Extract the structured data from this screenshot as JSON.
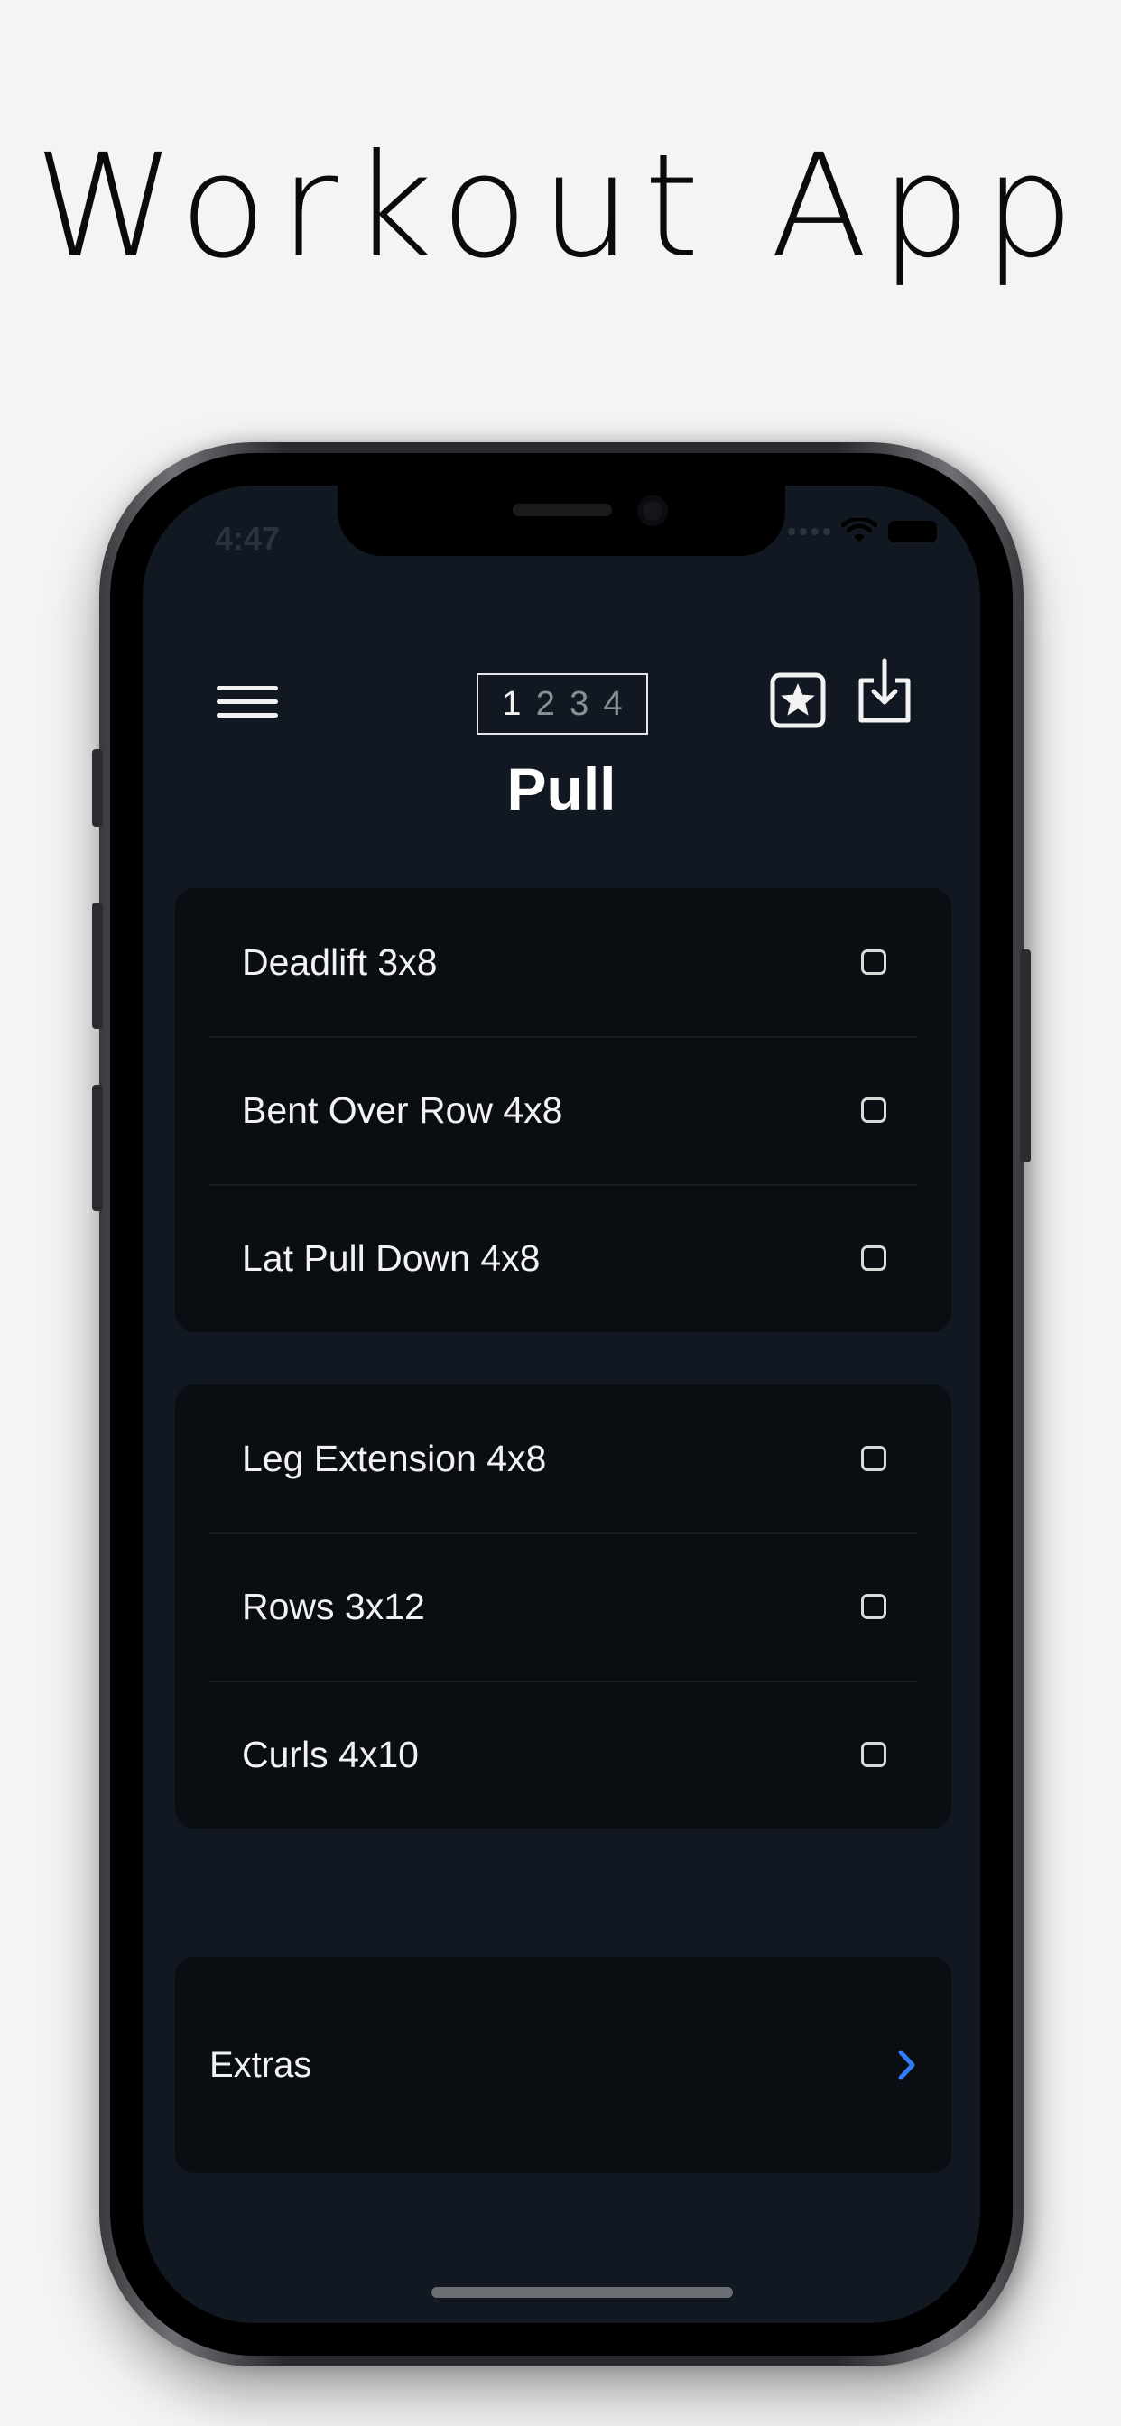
{
  "promo": {
    "title": "Workout App"
  },
  "status_bar": {
    "time": "4:47"
  },
  "header": {
    "menu_icon": "hamburger-menu-icon",
    "days": [
      "1",
      "2",
      "3",
      "4"
    ],
    "active_day": "1",
    "favorite_icon": "star-box-icon",
    "export_icon": "download-tray-icon",
    "title": "Pull"
  },
  "workout": {
    "group1": [
      {
        "label": "Deadlift 3x8",
        "checked": false
      },
      {
        "label": "Bent Over Row 4x8",
        "checked": false
      },
      {
        "label": "Lat Pull Down 4x8",
        "checked": false
      }
    ],
    "group2": [
      {
        "label": "Leg Extension 4x8",
        "checked": false
      },
      {
        "label": "Rows 3x12",
        "checked": false
      },
      {
        "label": "Curls 4x10",
        "checked": false
      }
    ]
  },
  "extras": {
    "label": "Extras",
    "chevron_color": "#2f7cf6"
  }
}
